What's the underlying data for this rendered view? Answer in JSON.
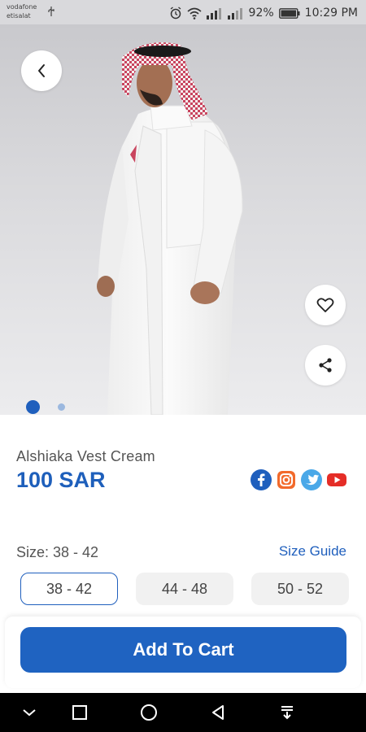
{
  "status_bar": {
    "carrier_1": "vodafone",
    "carrier_2": "etisalat",
    "battery": "92%",
    "time": "10:29 PM",
    "icons": [
      "usb-icon",
      "alarm-icon",
      "wifi-icon",
      "signal-icon",
      "signal-icon",
      "battery-icon"
    ]
  },
  "product": {
    "name": "Alshiaka Vest Cream",
    "price": "100 SAR",
    "image_count": 2,
    "active_image": 1
  },
  "social": [
    "facebook-icon",
    "instagram-icon",
    "twitter-icon",
    "youtube-icon"
  ],
  "size": {
    "label": "Size: 38 - 42",
    "guide": "Size Guide",
    "options": [
      "38 - 42",
      "44 - 48",
      "50 - 52"
    ],
    "selected": "38 - 42"
  },
  "cart": {
    "button": "Add To Cart"
  },
  "nav": [
    "chevron-down-icon",
    "square-icon",
    "circle-icon",
    "triangle-back-icon",
    "download-icon"
  ],
  "colors": {
    "accent": "#1f63c1",
    "price": "#1e5fbb",
    "size_guide": "#1f5fbd"
  }
}
